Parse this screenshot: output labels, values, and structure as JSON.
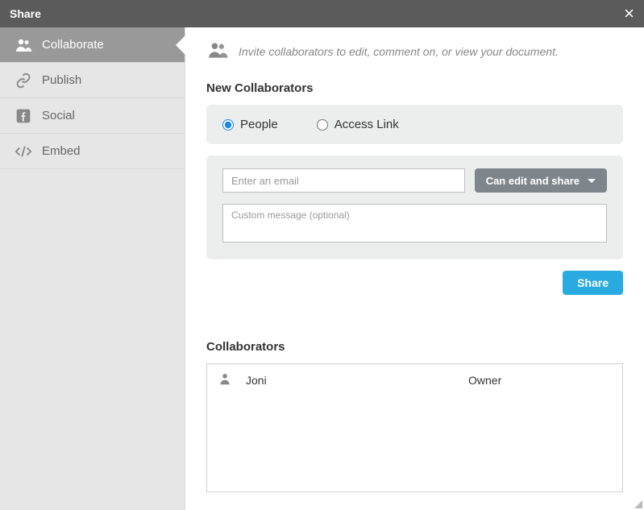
{
  "title": "Share",
  "sidebar": {
    "items": [
      {
        "id": "collaborate",
        "label": "Collaborate",
        "icon": "users-icon",
        "active": true
      },
      {
        "id": "publish",
        "label": "Publish",
        "icon": "link-icon",
        "active": false
      },
      {
        "id": "social",
        "label": "Social",
        "icon": "facebook-icon",
        "active": false
      },
      {
        "id": "embed",
        "label": "Embed",
        "icon": "code-icon",
        "active": false
      }
    ]
  },
  "main": {
    "intro": "Invite collaborators to edit, comment on, or view your document.",
    "new_collaborators_title": "New Collaborators",
    "radio": {
      "people": "People",
      "access_link": "Access Link",
      "selected": "people"
    },
    "email_placeholder": "Enter an email",
    "permission_label": "Can edit and share",
    "message_placeholder": "Custom message (optional)",
    "share_button": "Share",
    "collaborators_title": "Collaborators",
    "collaborators": [
      {
        "name": "Joni",
        "role": "Owner"
      }
    ]
  }
}
